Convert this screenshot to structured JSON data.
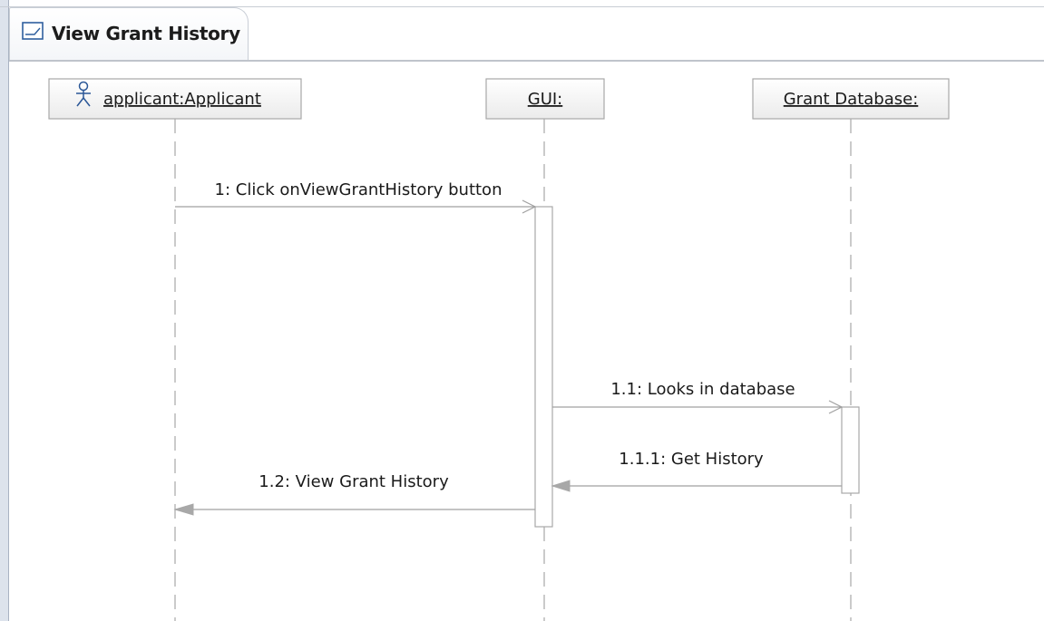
{
  "editor_tab": {
    "title": "View Grant History",
    "icon": "sequence-diagram-icon"
  },
  "diagram": {
    "lifelines": [
      {
        "id": "applicant",
        "label": "applicant:Applicant",
        "icon": "actor-icon"
      },
      {
        "id": "gui",
        "label": "GUI:"
      },
      {
        "id": "db",
        "label": "Grant Database:"
      }
    ],
    "messages": [
      {
        "id": "m1",
        "label": "1: Click onViewGrantHistory button",
        "from": "applicant",
        "to": "gui",
        "kind": "async"
      },
      {
        "id": "m2",
        "label": "1.1: Looks in database",
        "from": "gui",
        "to": "db",
        "kind": "async"
      },
      {
        "id": "m3",
        "label": "1.1.1: Get History",
        "from": "db",
        "to": "gui",
        "kind": "reply"
      },
      {
        "id": "m4",
        "label": "1.2: View Grant History",
        "from": "gui",
        "to": "applicant",
        "kind": "reply"
      }
    ]
  },
  "colors": {
    "box_fill_top": "#ffffff",
    "box_fill_bottom": "#ececec",
    "box_border": "#a8a8a8",
    "line": "#a0a0a0",
    "link_blue": "#2b5797"
  }
}
